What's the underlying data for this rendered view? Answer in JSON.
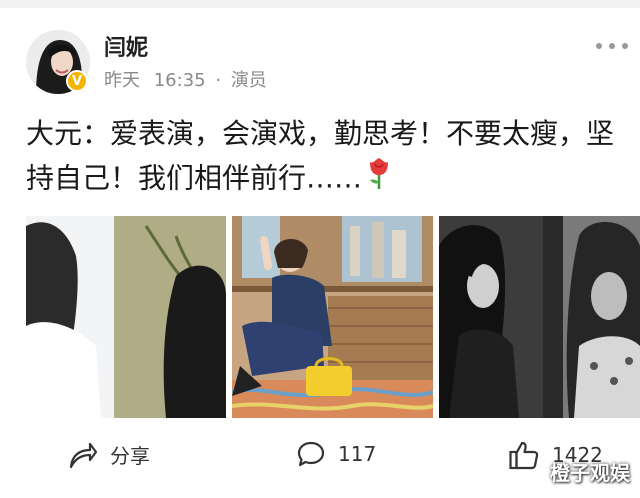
{
  "post": {
    "username": "闫妮",
    "meta": {
      "date": "昨天",
      "time": "16:35",
      "separator": "·",
      "role": "演员"
    },
    "content_line1": "大元：爱表演，会演戏，勤思考！不要太瘦，坚",
    "content_line2": "持自己！我们相伴前行……",
    "badge_letter": "V"
  },
  "actions": {
    "share_label": "分享",
    "comment_count": "117",
    "like_count": "1422"
  },
  "watermark": "橙子观娱",
  "colors": {
    "accent_badge": "#f5b400",
    "meta_gray": "#8a8a8a",
    "rose_red": "#e43b3b"
  },
  "icons": {
    "share": "share-arrow-icon",
    "comment": "comment-bubble-icon",
    "like": "thumbs-up-icon",
    "more": "more-dots-icon",
    "rose": "rose-emoji-icon"
  }
}
